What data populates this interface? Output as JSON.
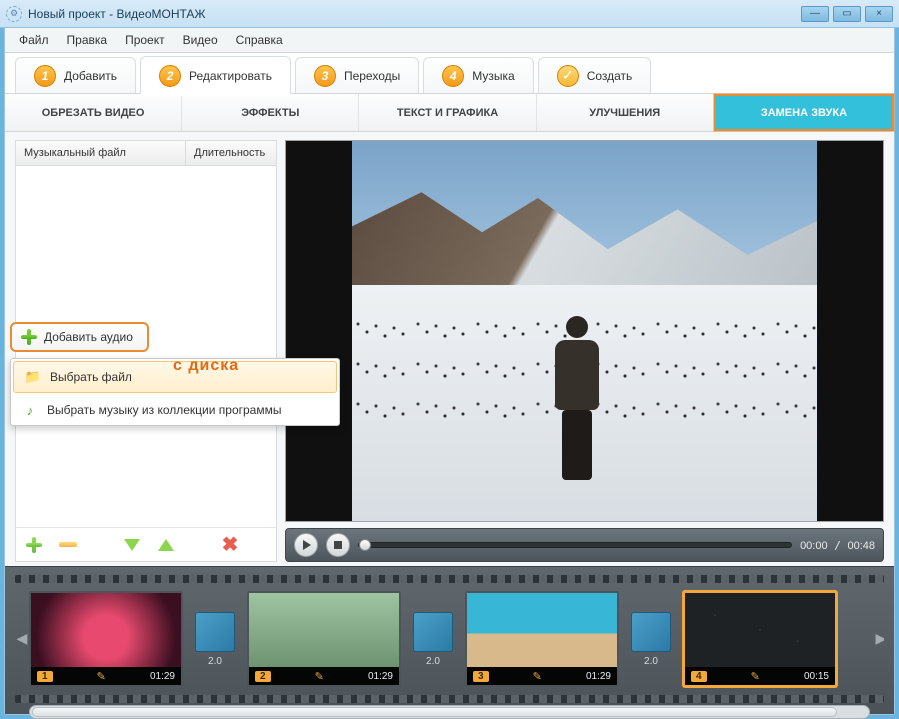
{
  "title": "Новый проект - ВидеоМОНТАЖ",
  "menubar": [
    "Файл",
    "Правка",
    "Проект",
    "Видео",
    "Справка"
  ],
  "steps": [
    {
      "num": "1",
      "label": "Добавить"
    },
    {
      "num": "2",
      "label": "Редактировать"
    },
    {
      "num": "3",
      "label": "Переходы"
    },
    {
      "num": "4",
      "label": "Музыка"
    },
    {
      "num": "✓",
      "label": "Создать"
    }
  ],
  "active_step": 1,
  "subtabs": [
    "ОБРЕЗАТЬ ВИДЕО",
    "ЭФФЕКТЫ",
    "ТЕКСТ И ГРАФИКА",
    "УЛУЧШЕНИЯ",
    "ЗАМЕНА ЗВУКА"
  ],
  "active_subtab": 4,
  "left_panel": {
    "col1": "Музыкальный файл",
    "col2": "Длительность",
    "add_audio": "Добавить аудио",
    "popup": {
      "item1": "Выбрать файл",
      "item2": "Выбрать музыку из коллекции программы",
      "annotation": "с диска"
    }
  },
  "player": {
    "time_current": "00:00",
    "time_total": "00:48"
  },
  "timeline": {
    "clips": [
      {
        "idx": "1",
        "dur": "01:29"
      },
      {
        "idx": "2",
        "dur": "01:29"
      },
      {
        "idx": "3",
        "dur": "01:29"
      },
      {
        "idx": "4",
        "dur": "00:15"
      }
    ],
    "trans_time": "2.0",
    "selected": 3
  }
}
